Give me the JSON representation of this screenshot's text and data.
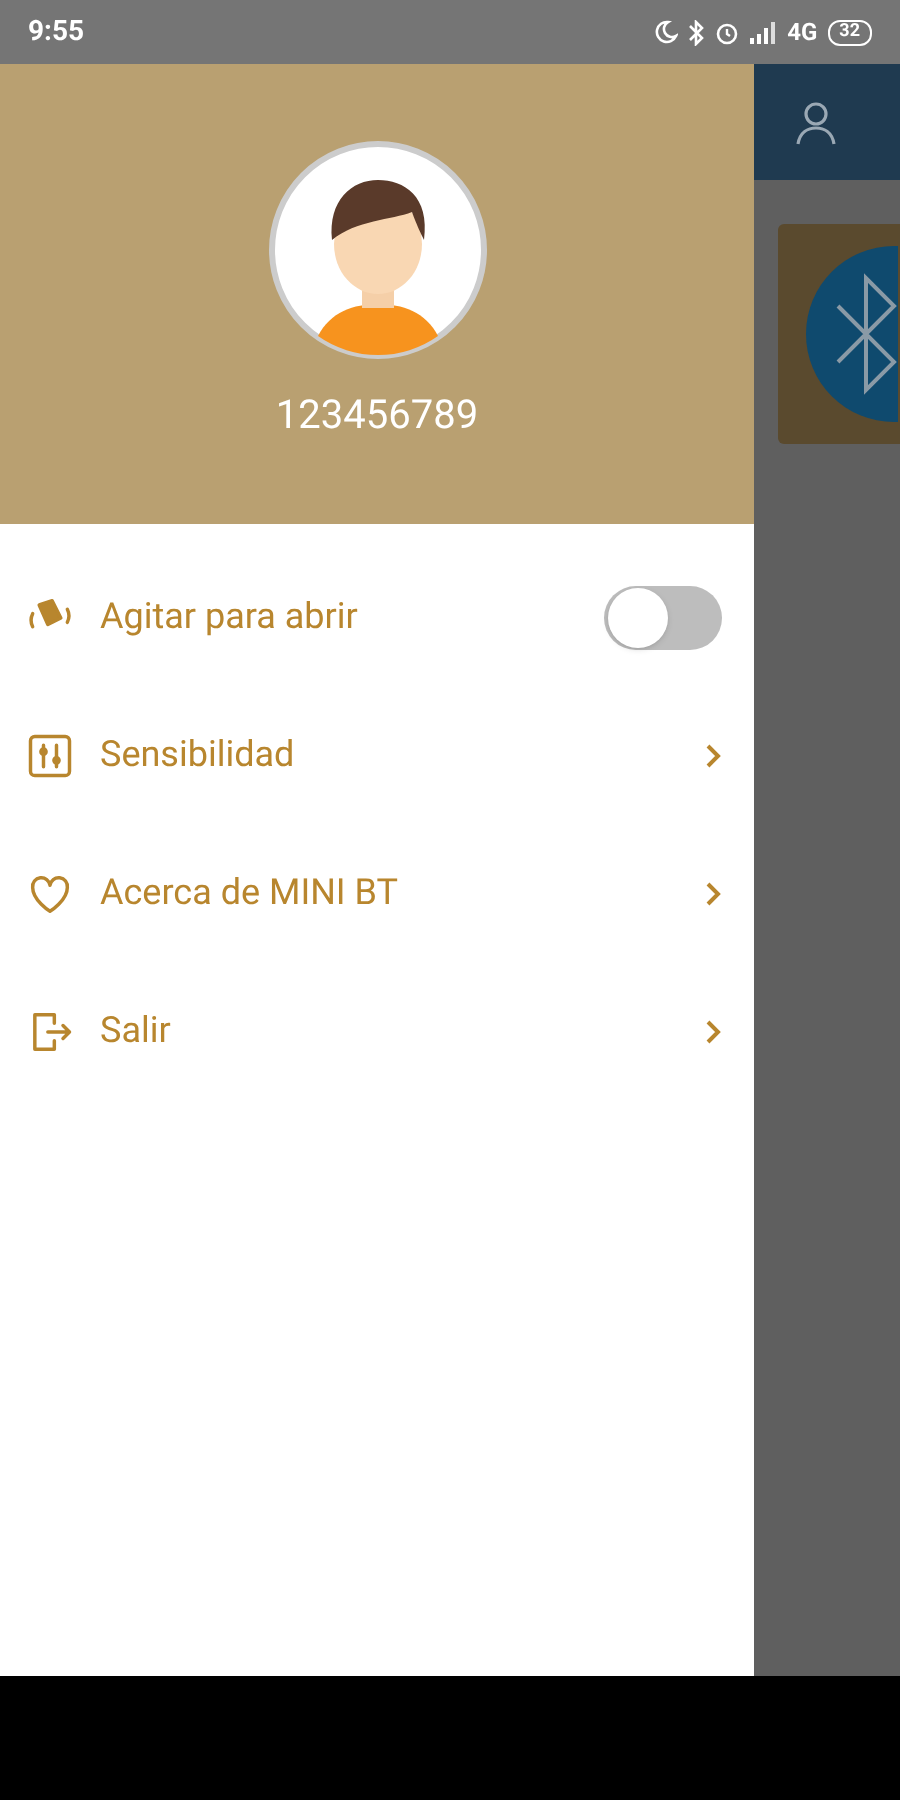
{
  "status_bar": {
    "time": "9:55",
    "network": "4G",
    "battery": "32"
  },
  "drawer": {
    "username": "123456789",
    "items": [
      {
        "kind": "toggle",
        "label": "Agitar para abrir",
        "on": false
      },
      {
        "kind": "link",
        "label": "Sensibilidad"
      },
      {
        "kind": "link",
        "label": "Acerca de MINI BT"
      },
      {
        "kind": "link",
        "label": "Salir"
      }
    ]
  }
}
